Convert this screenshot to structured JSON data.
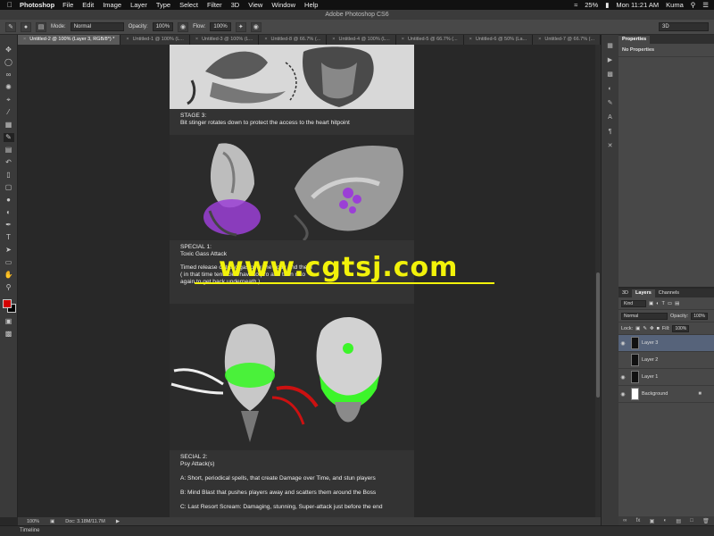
{
  "menubar": {
    "app": "Photoshop",
    "menus": [
      "File",
      "Edit",
      "Image",
      "Layer",
      "Type",
      "Select",
      "Filter",
      "3D",
      "View",
      "Window",
      "Help"
    ],
    "battery": "25%",
    "clock": "Mon 11:21 AM",
    "user": "Kuma"
  },
  "window": {
    "title": "Adobe Photoshop CS6"
  },
  "options": {
    "mode_label": "Mode:",
    "mode_value": "Normal",
    "opacity_label": "Opacity:",
    "opacity_value": "100%",
    "flow_label": "Flow:",
    "flow_value": "100%",
    "workspace": "3D"
  },
  "doc_tabs": [
    "Untitled-2 @ 100% (Layer 3, RGB/8*) *",
    "Untitled-1 @ 100% (L...",
    "Untitled-3 @ 100% (L...",
    "Untitled-8 @ 66.7% (...",
    "Untitled-4 @ 100% (L...",
    "Untitled-5 @ 66.7% (...",
    "Untitled-6 @ 50% (La...",
    "Untitled-7 @ 66.7% (..."
  ],
  "document": {
    "stage3_title": "STAGE 3:",
    "stage3_text": "Bit stinger rotates down to protect the access to the heart hitpoint",
    "special1_title": "SPECIAL 1:",
    "special1_name": "Toxic Gass Attack",
    "special1_line1": "Timed release of toxic gas over the body and the h",
    "special1_line2": "( in that time tentacles have to pro   and then reto",
    "special1_line3": "again to get back underneath )",
    "special2_title": "SECIAL 2:",
    "special2_name": "Psy Attack(s)",
    "special2_a": "A: Short, periodical spells, that create Damage over Time, and stun players",
    "special2_b": "B: Mind Blast that pushes players away and scatters them around the Boss",
    "special2_c": "C: Last Resort Scream: Damaging, stunning, Super-attack just before the end"
  },
  "watermark": "www.cgtsj.com",
  "status": {
    "zoom": "100%",
    "doc_size": "Doc: 3.18M/11.7M"
  },
  "timeline": {
    "label": "Timeline"
  },
  "properties": {
    "tab": "Properties",
    "empty_text": "No Properties"
  },
  "layers_panel": {
    "tabs": [
      "3D",
      "Layers",
      "Channels"
    ],
    "filter_kind": "Kind",
    "blend_mode": "Normal",
    "opacity_label": "Opacity:",
    "opacity_value": "100%",
    "lock_label": "Lock:",
    "fill_label": "Fill:",
    "fill_value": "100%",
    "layers": [
      {
        "name": "Layer 3",
        "selected": true
      },
      {
        "name": "Layer 2",
        "selected": false
      },
      {
        "name": "Layer 1",
        "selected": false
      },
      {
        "name": "Background",
        "selected": false
      }
    ]
  },
  "colors": {
    "foreground": "#d40000",
    "background": "#000000",
    "watermark": "#f2f20a",
    "toxic_gas": "#9b3fd6",
    "psy_glow": "#3cf52a"
  }
}
